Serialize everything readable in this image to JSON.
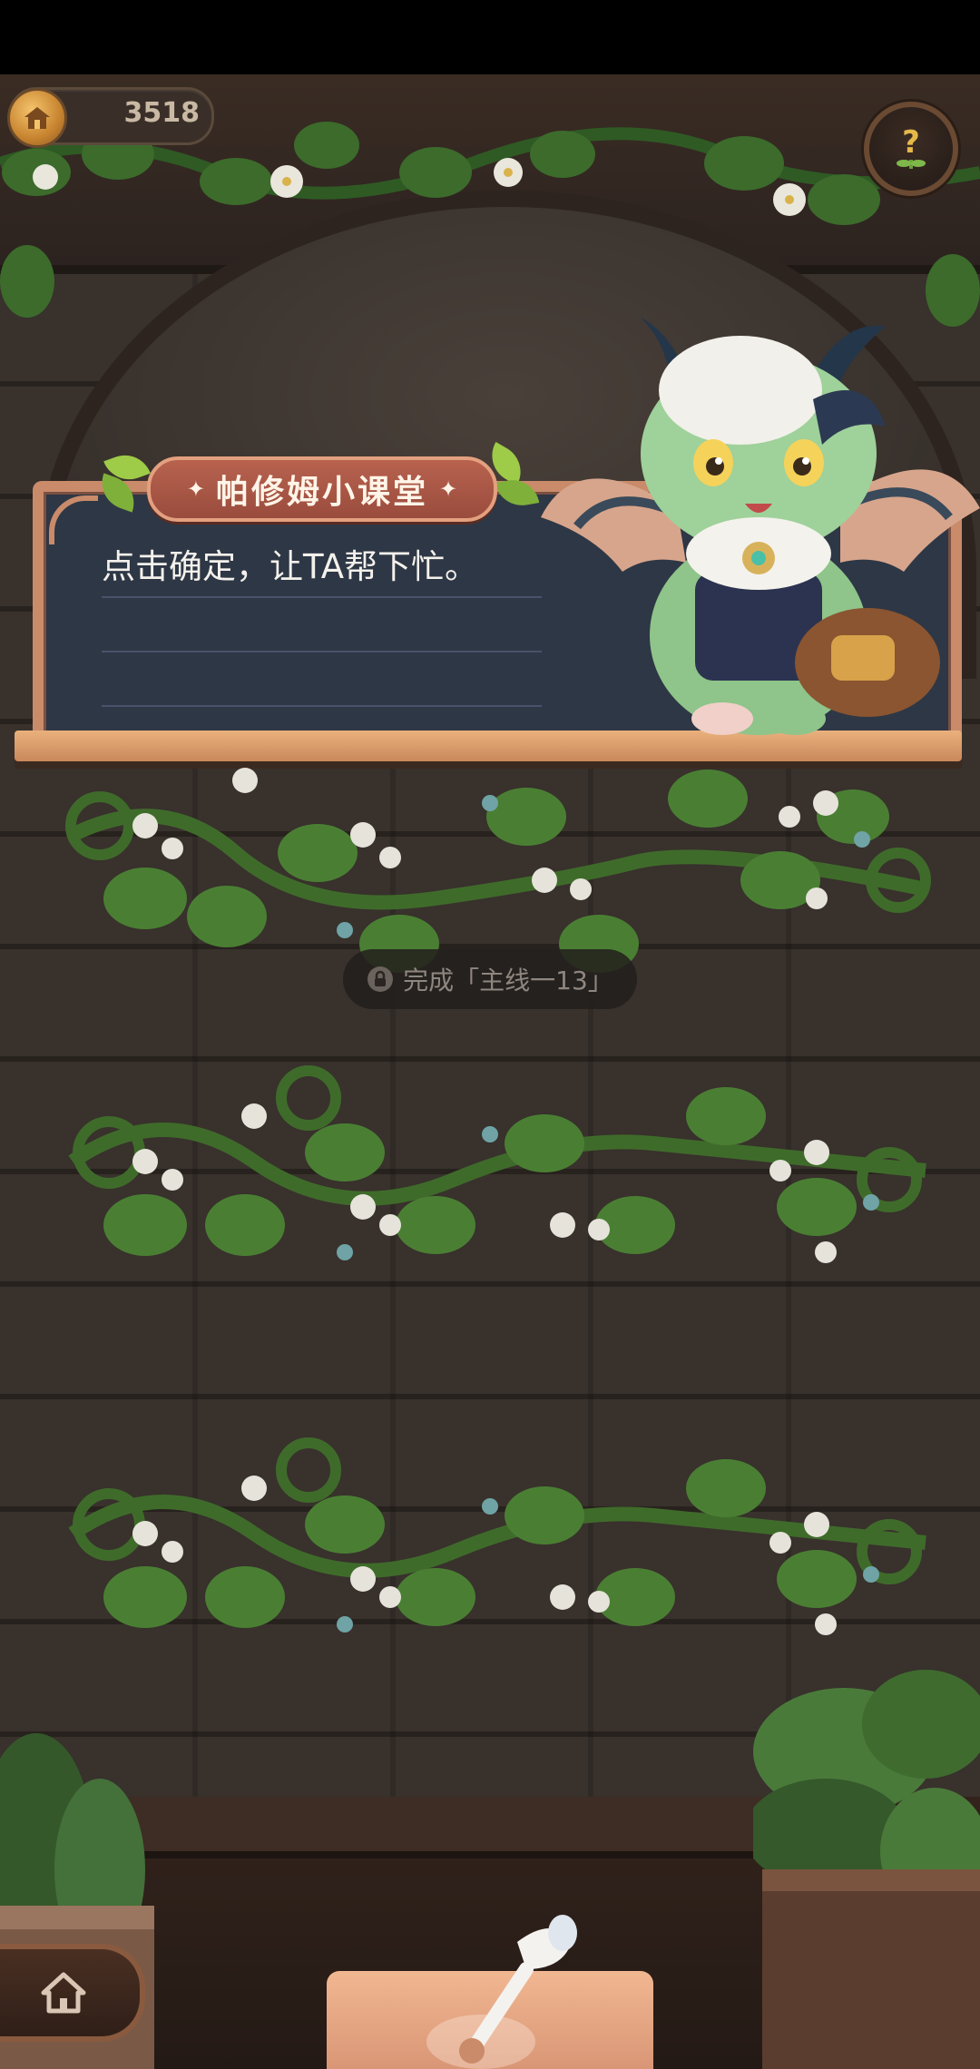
{
  "status_bar": {},
  "currency": {
    "amount": "3518",
    "icon": "coin-house-icon"
  },
  "help_button": {
    "icon": "question-sprout-icon"
  },
  "lesson_board": {
    "title": "帕修姆小课堂",
    "message": "点击确定，让TA帮下忙。"
  },
  "locked_slot": {
    "icon": "lock-icon",
    "requirement_text": "完成「主线一13」"
  },
  "bottom_bar": {
    "home_icon": "home-icon",
    "tool_icon": "watering-can-icon"
  },
  "colors": {
    "board_bg": "#2e3745",
    "board_frame": "#c98b6a",
    "banner": "#a9584a",
    "leaf": "#9ecb48",
    "vine": "#3f6b2a"
  }
}
